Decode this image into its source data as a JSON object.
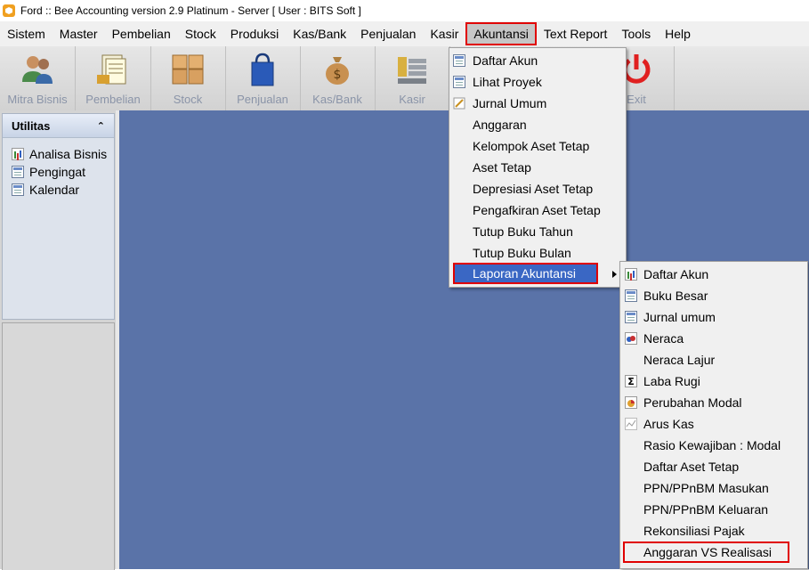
{
  "window": {
    "title": "Ford  :: Bee Accounting version 2.9 Platinum - Server  [ User : BITS Soft ]"
  },
  "menubar": {
    "items": [
      "Sistem",
      "Master",
      "Pembelian",
      "Stock",
      "Produksi",
      "Kas/Bank",
      "Penjualan",
      "Kasir",
      "Akuntansi",
      "Text Report",
      "Tools",
      "Help"
    ],
    "active": "Akuntansi"
  },
  "toolbar": {
    "buttons": [
      {
        "label": "Mitra Bisnis",
        "icon": "people-icon"
      },
      {
        "label": "Pembelian",
        "icon": "invoice-icon"
      },
      {
        "label": "Stock",
        "icon": "boxes-icon"
      },
      {
        "label": "Penjualan",
        "icon": "shopping-bag-icon"
      },
      {
        "label": "Kas/Bank",
        "icon": "money-bag-icon"
      },
      {
        "label": "Kasir",
        "icon": "cash-register-icon"
      },
      {
        "label": "Exit",
        "icon": "power-icon"
      }
    ]
  },
  "leftpanel": {
    "header": "Utilitas",
    "items": [
      {
        "label": "Analisa Bisnis",
        "icon": "bar-chart-icon"
      },
      {
        "label": "Pengingat",
        "icon": "list-icon"
      },
      {
        "label": "Kalendar",
        "icon": "calendar-icon"
      }
    ]
  },
  "akuntansi_menu": {
    "items": [
      {
        "label": "Daftar Akun",
        "icon": "grid-icon"
      },
      {
        "label": "Lihat Proyek",
        "icon": "grid-icon"
      },
      {
        "label": "Jurnal Umum",
        "icon": "pen-icon"
      },
      {
        "label": "Anggaran",
        "icon": ""
      },
      {
        "label": "Kelompok Aset Tetap",
        "icon": ""
      },
      {
        "label": "Aset Tetap",
        "icon": ""
      },
      {
        "label": "Depresiasi Aset Tetap",
        "icon": ""
      },
      {
        "label": "Pengafkiran Aset Tetap",
        "icon": ""
      },
      {
        "label": "Tutup Buku Tahun",
        "icon": ""
      },
      {
        "label": "Tutup Buku Bulan",
        "icon": ""
      },
      {
        "label": "Laporan Akuntansi",
        "icon": ""
      }
    ],
    "highlighted": "Laporan Akuntansi"
  },
  "laporan_submenu": {
    "items": [
      {
        "label": "Daftar Akun",
        "icon": "bar-chart-icon"
      },
      {
        "label": "Buku Besar",
        "icon": "ledger-icon"
      },
      {
        "label": "Jurnal umum",
        "icon": "journal-icon"
      },
      {
        "label": "Neraca",
        "icon": "balance-chart-icon"
      },
      {
        "label": "Neraca Lajur",
        "icon": ""
      },
      {
        "label": "Laba Rugi",
        "icon": "sigma-icon"
      },
      {
        "label": "Perubahan Modal",
        "icon": "pie-chart-icon"
      },
      {
        "label": "Arus Kas",
        "icon": "line-chart-icon"
      },
      {
        "label": "Rasio Kewajiban : Modal",
        "icon": ""
      },
      {
        "label": "Daftar Aset Tetap",
        "icon": ""
      },
      {
        "label": "PPN/PPnBM Masukan",
        "icon": ""
      },
      {
        "label": "PPN/PPnBM Keluaran",
        "icon": ""
      },
      {
        "label": "Rekonsiliasi Pajak",
        "icon": ""
      },
      {
        "label": "Anggaran VS Realisasi",
        "icon": ""
      }
    ],
    "boxed": "Anggaran VS Realisasi"
  },
  "colors": {
    "main_background": "#5a73a8",
    "menu_highlight": "#3a67c4",
    "annotation_red": "#e00000",
    "exit_red": "#e02020"
  }
}
